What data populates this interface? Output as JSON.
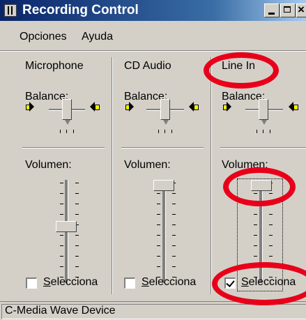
{
  "window": {
    "title": "Recording Control",
    "close_glyph": "×"
  },
  "menu": {
    "items": [
      "Opciones",
      "Ayuda"
    ]
  },
  "columns": [
    {
      "name": "Microphone",
      "balance_label": "Balance:",
      "volume_label": "Volumen:",
      "select_label": "Selecciona",
      "select_underline": "S",
      "select_rest": "elecciona",
      "selected": false,
      "volume_level": 0.55
    },
    {
      "name": "CD Audio",
      "balance_label": "Balance:",
      "volume_label": "Volumen:",
      "select_label": "Selecciona",
      "select_underline": "S",
      "select_rest": "elecciona",
      "selected": false,
      "volume_level": 1.0
    },
    {
      "name": "Line In",
      "balance_label": "Balance:",
      "volume_label": "Volumen:",
      "select_label": "Selecciona",
      "select_underline": "S",
      "select_rest": "elecciona",
      "selected": true,
      "volume_level": 1.0
    }
  ],
  "status": {
    "device": "C-Media Wave Device"
  },
  "colors": {
    "titlebar_start": "#0a246a",
    "titlebar_end": "#a6caf0",
    "face": "#d4d0c8",
    "highlight_ring": "#e8001a"
  }
}
